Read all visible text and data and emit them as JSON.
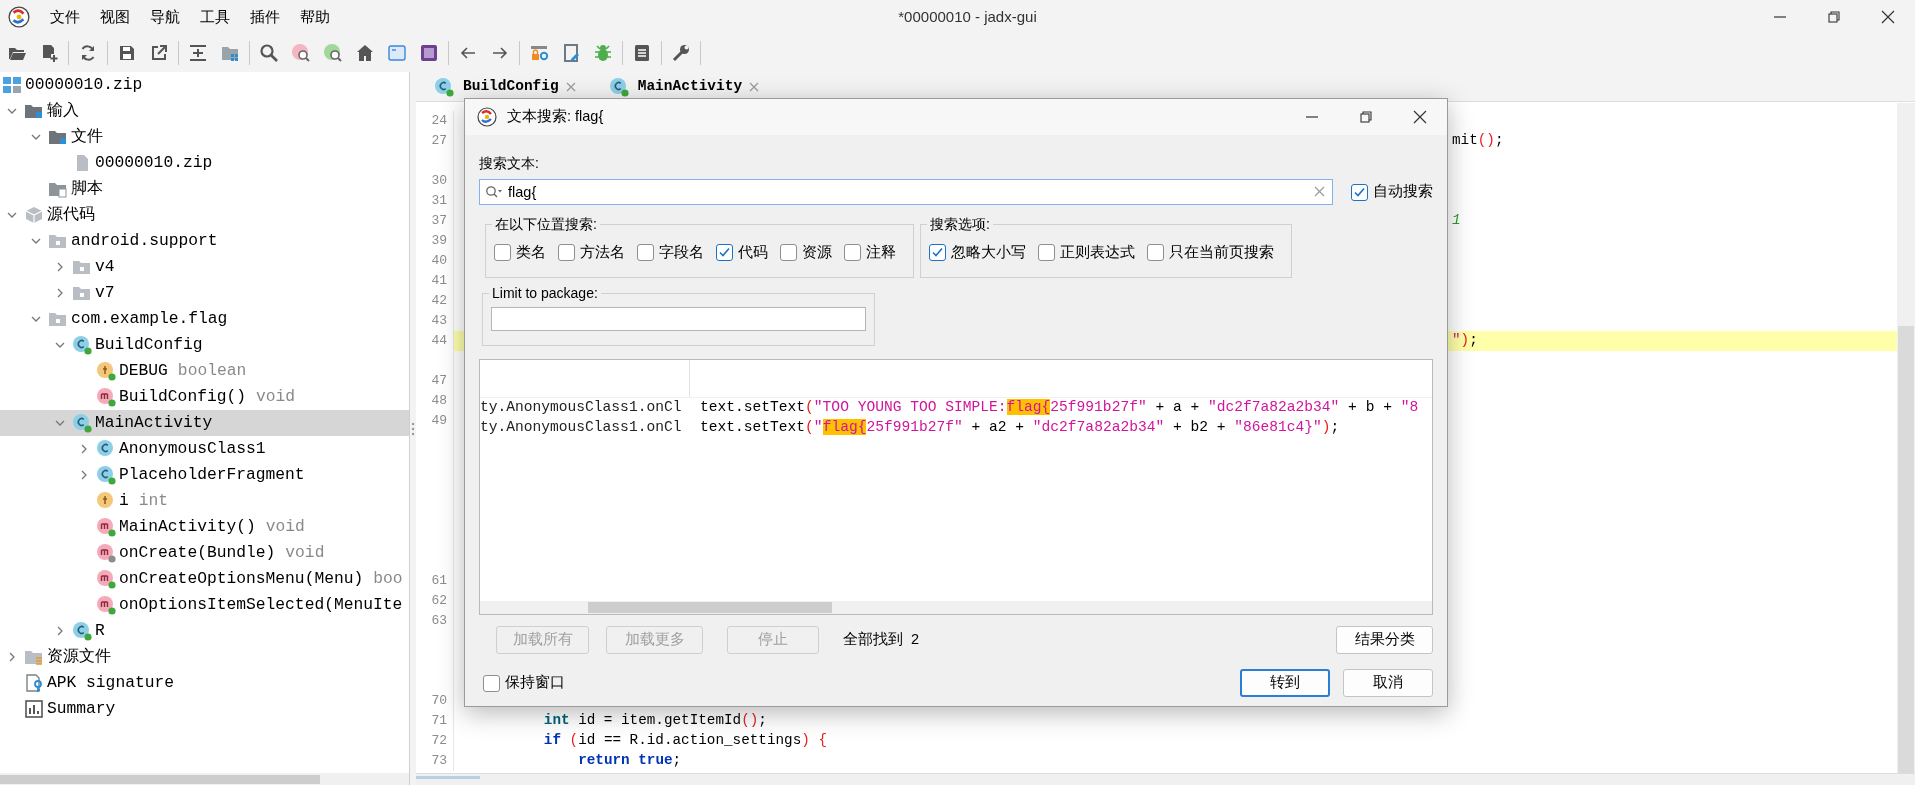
{
  "window": {
    "title": "*00000010 - jadx-gui"
  },
  "menu": [
    "文件",
    "视图",
    "导航",
    "工具",
    "插件",
    "帮助"
  ],
  "tree": {
    "label": "00000010.zip",
    "kind": "zip",
    "selected": false,
    "children": [
      {
        "label": "输入",
        "kind": "input",
        "expanded": true,
        "selected": false,
        "children": [
          {
            "label": "文件",
            "kind": "files",
            "expanded": true,
            "selected": false,
            "children": [
              {
                "label": "00000010.zip",
                "kind": "file",
                "selected": false
              }
            ]
          },
          {
            "label": "脚本",
            "kind": "scripts",
            "selected": false
          }
        ]
      },
      {
        "label": "源代码",
        "kind": "sources",
        "expanded": true,
        "selected": false,
        "children": [
          {
            "label": "android.support",
            "kind": "package",
            "expanded": true,
            "selected": false,
            "children": [
              {
                "label": "v4",
                "kind": "package",
                "expanded": false,
                "selected": false
              },
              {
                "label": "v7",
                "kind": "package",
                "expanded": false,
                "selected": false
              }
            ]
          },
          {
            "label": "com.example.flag",
            "kind": "package",
            "expanded": true,
            "selected": false,
            "children": [
              {
                "label": "BuildConfig",
                "kind": "class",
                "color": "#3ea83e",
                "expanded": true,
                "selected": false,
                "children": [
                  {
                    "label": "DEBUG",
                    "type": "boolean",
                    "kind": "field",
                    "color": "#3ea83e",
                    "selected": false
                  },
                  {
                    "label": "BuildConfig()",
                    "type": "void",
                    "kind": "method",
                    "color": "#3ea83e",
                    "selected": false
                  }
                ]
              },
              {
                "label": "MainActivity",
                "kind": "class",
                "color": "#3ea83e",
                "expanded": true,
                "selected": true,
                "children": [
                  {
                    "label": "AnonymousClass1",
                    "kind": "class",
                    "expanded": false,
                    "selected": false
                  },
                  {
                    "label": "PlaceholderFragment",
                    "kind": "class",
                    "color": "#3ea83e",
                    "expanded": false,
                    "selected": false
                  },
                  {
                    "label": "i",
                    "type": "int",
                    "kind": "field",
                    "selected": false
                  },
                  {
                    "label": "MainActivity()",
                    "type": "void",
                    "kind": "method",
                    "color": "#3ea83e",
                    "selected": false
                  },
                  {
                    "label": "onCreate(Bundle)",
                    "type": "void",
                    "kind": "method",
                    "color": "#8d8d8d",
                    "selected": false
                  },
                  {
                    "label": "onCreateOptionsMenu(Menu)",
                    "type": "boo",
                    "kind": "method",
                    "color": "#3ea83e",
                    "selected": false
                  },
                  {
                    "label": "onOptionsItemSelected(MenuIte",
                    "kind": "method",
                    "color": "#3ea83e",
                    "selected": false
                  }
                ]
              },
              {
                "label": "R",
                "kind": "class",
                "color": "#3ea83e",
                "expanded": false,
                "selected": false
              }
            ]
          }
        ]
      },
      {
        "label": "资源文件",
        "kind": "resources",
        "expanded": false,
        "selected": false
      },
      {
        "label": "APK signature",
        "kind": "signature",
        "selected": false
      },
      {
        "label": "Summary",
        "kind": "summary",
        "selected": false
      }
    ]
  },
  "tabs": [
    {
      "label": "BuildConfig",
      "kind": "class"
    },
    {
      "label": "MainActivity",
      "kind": "class"
    }
  ],
  "lines": [
    {
      "num": "24",
      "highlighted": false
    },
    {
      "num": "27",
      "highlighted": false,
      "tail": [
        {
          "text": "mit",
          "kind": "plain"
        },
        {
          "text": "()",
          "kind": "paren"
        },
        {
          "text": ";",
          "kind": "plain"
        }
      ]
    },
    {
      "highlighted": false
    },
    {
      "num": "30",
      "highlighted": false
    },
    {
      "num": "31",
      "highlighted": false
    },
    {
      "num": "37",
      "highlighted": false,
      "tail": [
        {
          "text": "1",
          "kind": "comment"
        }
      ]
    },
    {
      "num": "39",
      "highlighted": false
    },
    {
      "num": "40",
      "highlighted": false
    },
    {
      "num": "41",
      "highlighted": false
    },
    {
      "num": "42",
      "highlighted": false
    },
    {
      "num": "43",
      "highlighted": false
    },
    {
      "num": "44",
      "highlighted": true,
      "tail": [
        {
          "text": "\"",
          "kind": "string"
        },
        {
          "text": ")",
          "kind": "paren"
        },
        {
          "text": ";",
          "kind": "plain"
        }
      ]
    },
    {
      "highlighted": false
    },
    {
      "num": "47",
      "highlighted": false
    },
    {
      "num": "48",
      "highlighted": false
    },
    {
      "num": "49",
      "highlighted": false
    },
    {
      "highlighted": false
    },
    {
      "highlighted": false
    },
    {
      "highlighted": false
    },
    {
      "highlighted": false
    },
    {
      "highlighted": false
    },
    {
      "highlighted": false
    },
    {
      "highlighted": false
    },
    {
      "num": "61",
      "highlighted": false
    },
    {
      "num": "62",
      "highlighted": false
    },
    {
      "num": "63",
      "highlighted": false
    },
    {
      "highlighted": false
    },
    {
      "highlighted": false
    },
    {
      "highlighted": false
    },
    {
      "num": "70",
      "highlighted": false
    },
    {
      "num": "71",
      "highlighted": false,
      "code": [
        {
          "text": "int",
          "kind": "type"
        },
        {
          "text": " id = item.getItemId",
          "kind": "plain"
        },
        {
          "text": "()",
          "kind": "paren"
        },
        {
          "text": ";",
          "kind": "plain"
        }
      ]
    },
    {
      "num": "72",
      "highlighted": false,
      "code": [
        {
          "text": "if",
          "kind": "keyword"
        },
        {
          "text": " (",
          "kind": "paren"
        },
        {
          "text": "id == R.id.action_settings",
          "kind": "plain"
        },
        {
          "text": ") {",
          "kind": "paren"
        }
      ],
      "children": [
        {
          "num": "73",
          "highlighted": false,
          "code": [
            {
              "text": "return",
              "kind": "keyword"
            },
            {
              "text": " true",
              "kind": "keyword"
            },
            {
              "text": ";",
              "kind": "plain"
            }
          ]
        }
      ]
    }
  ],
  "dialog": {
    "title": "文本搜索: flag{",
    "search_label": "搜索文本:",
    "search": {
      "value": "flag{"
    },
    "auto_search": {
      "label": "自动搜索",
      "checked": true
    },
    "search_in": {
      "title": "在以下位置搜索:",
      "options": [
        {
          "label": "类名",
          "checked": false
        },
        {
          "label": "方法名",
          "checked": false
        },
        {
          "label": "字段名",
          "checked": false
        },
        {
          "label": "代码",
          "checked": true
        },
        {
          "label": "资源",
          "checked": false
        },
        {
          "label": "注释",
          "checked": false
        }
      ]
    },
    "search_options": {
      "title": "搜索选项:",
      "options": [
        {
          "label": "忽略大小写",
          "checked": true
        },
        {
          "label": "正则表达式",
          "checked": false
        },
        {
          "label": "只在当前页搜索",
          "checked": false
        }
      ]
    },
    "limit": {
      "title": "Limit to package:"
    },
    "results": [
      {
        "location": "ty.AnonymousClass1.onCl",
        "code": [
          {
            "text": "text.setText",
            "kind": "plain"
          },
          {
            "text": "(",
            "kind": "paren"
          },
          {
            "text": "\"TOO YOUNG TOO SIMPLE:",
            "kind": "string"
          },
          {
            "text": "flag{",
            "kind": "match"
          },
          {
            "text": "25f991b27f\"",
            "kind": "string"
          },
          {
            "text": " + a + ",
            "kind": "plain"
          },
          {
            "text": "\"dc2f7a82a2b34\"",
            "kind": "string"
          },
          {
            "text": " + b + ",
            "kind": "plain"
          },
          {
            "text": "\"8",
            "kind": "string"
          }
        ]
      },
      {
        "location": "ty.AnonymousClass1.onCl",
        "code": [
          {
            "text": "text.setText",
            "kind": "plain"
          },
          {
            "text": "(",
            "kind": "paren"
          },
          {
            "text": "\"",
            "kind": "string"
          },
          {
            "text": "flag{",
            "kind": "match"
          },
          {
            "text": "25f991b27f\"",
            "kind": "string"
          },
          {
            "text": " + a2 + ",
            "kind": "plain"
          },
          {
            "text": "\"dc2f7a82a2b34\"",
            "kind": "string"
          },
          {
            "text": " + b2 + ",
            "kind": "plain"
          },
          {
            "text": "\"86e81c4}\"",
            "kind": "string"
          },
          {
            "text": ")",
            "kind": "paren"
          },
          {
            "text": ";",
            "kind": "plain"
          }
        ]
      }
    ],
    "load_buttons": [
      {
        "label": "加载所有",
        "disabled": true
      },
      {
        "label": "加载更多",
        "disabled": true
      },
      {
        "label": "停止",
        "disabled": true
      }
    ],
    "found": "全部找到  2",
    "group_button": "结果分类",
    "keep_open": {
      "label": "保持窗口",
      "checked": false
    },
    "actions": [
      {
        "label": "转到",
        "default": true
      },
      {
        "label": "取消",
        "default": false
      }
    ]
  }
}
